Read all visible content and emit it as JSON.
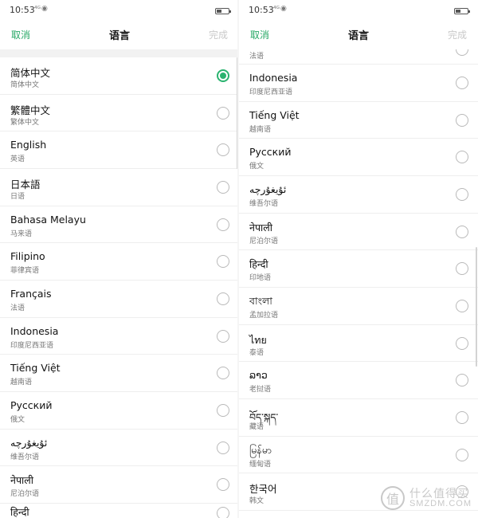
{
  "left_screen": {
    "status": {
      "time": "10:53",
      "signal": "⁴ᴳ",
      "wifi": "◉"
    },
    "nav": {
      "cancel": "取消",
      "title": "语言",
      "done": "完成"
    },
    "items": [
      {
        "name": "简体中文",
        "sub": "简体中文",
        "selected": true
      },
      {
        "name": "繁體中文",
        "sub": "繁体中文",
        "selected": false
      },
      {
        "name": "English",
        "sub": "英语",
        "selected": false
      },
      {
        "name": "日本語",
        "sub": "日语",
        "selected": false
      },
      {
        "name": "Bahasa Melayu",
        "sub": "马来语",
        "selected": false
      },
      {
        "name": "Filipino",
        "sub": "菲律宾语",
        "selected": false
      },
      {
        "name": "Français",
        "sub": "法语",
        "selected": false
      },
      {
        "name": "Indonesia",
        "sub": "印度尼西亚语",
        "selected": false
      },
      {
        "name": "Tiếng Việt",
        "sub": "越南语",
        "selected": false
      },
      {
        "name": "Русский",
        "sub": "俄文",
        "selected": false
      },
      {
        "name": "ئۇيغۇرچە",
        "sub": "维吾尔语",
        "selected": false
      },
      {
        "name": "नेपाली",
        "sub": "尼泊尔语",
        "selected": false
      }
    ],
    "partial_bottom": {
      "name": "हिन्दी"
    }
  },
  "right_screen": {
    "status": {
      "time": "10:53",
      "signal": "⁴ᴳ",
      "wifi": "◉"
    },
    "nav": {
      "cancel": "取消",
      "title": "语言",
      "done": "完成"
    },
    "partial_top": {
      "sub": "法语"
    },
    "items": [
      {
        "name": "Indonesia",
        "sub": "印度尼西亚语",
        "selected": false
      },
      {
        "name": "Tiếng Việt",
        "sub": "越南语",
        "selected": false
      },
      {
        "name": "Русский",
        "sub": "俄文",
        "selected": false
      },
      {
        "name": "ئۇيغۇرچە",
        "sub": "维吾尔语",
        "selected": false
      },
      {
        "name": "नेपाली",
        "sub": "尼泊尔语",
        "selected": false
      },
      {
        "name": "हिन्दी",
        "sub": "印地语",
        "selected": false
      },
      {
        "name": "বাংলা",
        "sub": "孟加拉语",
        "selected": false
      },
      {
        "name": "ไทย",
        "sub": "泰语",
        "selected": false
      },
      {
        "name": "ລາວ",
        "sub": "老挝语",
        "selected": false
      },
      {
        "name": "བོད་སྐད་",
        "sub": "藏语",
        "selected": false
      },
      {
        "name": "မြန်မာ",
        "sub": "缅甸语",
        "selected": false
      },
      {
        "name": "한국어",
        "sub": "韩文",
        "selected": false
      }
    ]
  },
  "watermark": {
    "badge": "值",
    "cn": "什么值得买",
    "en": "SMZDM.COM"
  },
  "colors": {
    "accent": "#2ab36f",
    "cancel_text": "#27a866",
    "done_disabled": "#c9c9c9"
  }
}
